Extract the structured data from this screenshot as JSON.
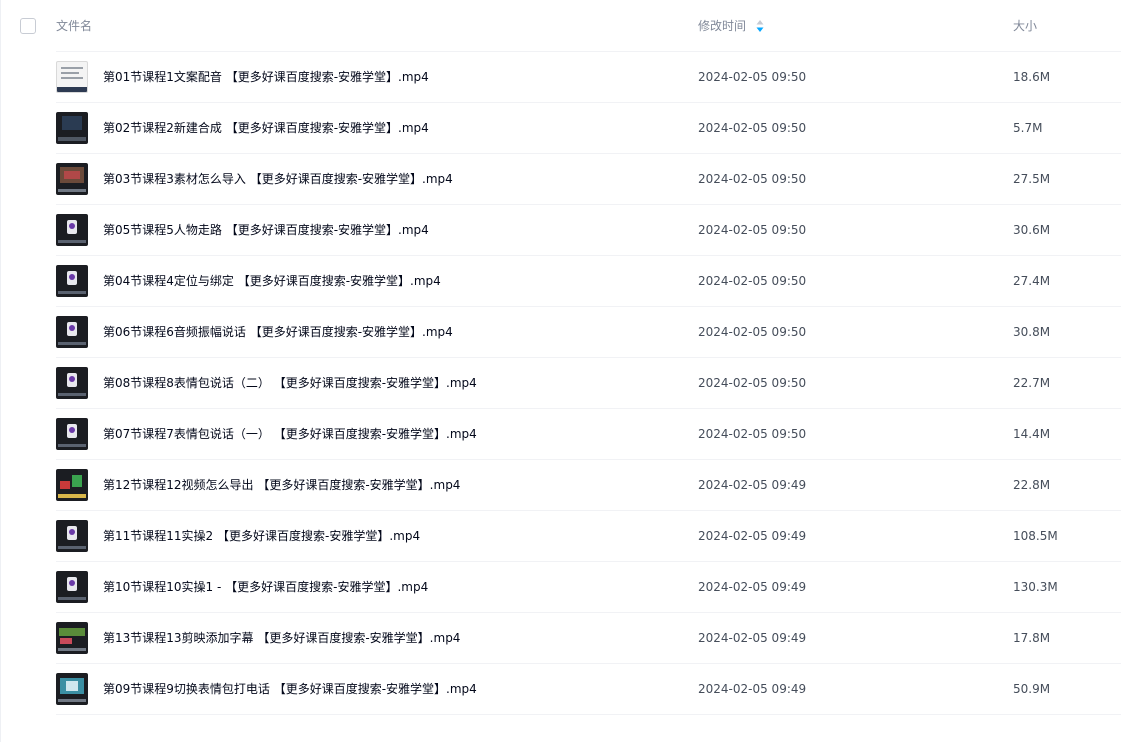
{
  "header": {
    "name_label": "文件名",
    "mtime_label": "修改时间",
    "size_label": "大小",
    "sort_indicator_icon": "sort-arrow-icon",
    "accent_color": "#06a7ff"
  },
  "files": [
    {
      "name": "第01节课程1文案配音 【更多好课百度搜索-安雅学堂】.mp4",
      "mtime": "2024-02-05 09:50",
      "size": "18.6M",
      "thumb": "doc"
    },
    {
      "name": "第02节课程2新建合成 【更多好课百度搜索-安雅学堂】.mp4",
      "mtime": "2024-02-05 09:50",
      "size": "5.7M",
      "thumb": "dark"
    },
    {
      "name": "第03节课程3素材怎么导入 【更多好课百度搜索-安雅学堂】.mp4",
      "mtime": "2024-02-05 09:50",
      "size": "27.5M",
      "thumb": "warm"
    },
    {
      "name": "第05节课程5人物走路 【更多好课百度搜索-安雅学堂】.mp4",
      "mtime": "2024-02-05 09:50",
      "size": "30.6M",
      "thumb": "fig"
    },
    {
      "name": "第04节课程4定位与绑定 【更多好课百度搜索-安雅学堂】.mp4",
      "mtime": "2024-02-05 09:50",
      "size": "27.4M",
      "thumb": "fig"
    },
    {
      "name": "第06节课程6音频振幅说话 【更多好课百度搜索-安雅学堂】.mp4",
      "mtime": "2024-02-05 09:50",
      "size": "30.8M",
      "thumb": "fig"
    },
    {
      "name": "第08节课程8表情包说话（二） 【更多好课百度搜索-安雅学堂】.mp4",
      "mtime": "2024-02-05 09:50",
      "size": "22.7M",
      "thumb": "fig"
    },
    {
      "name": "第07节课程7表情包说话（一） 【更多好课百度搜索-安雅学堂】.mp4",
      "mtime": "2024-02-05 09:50",
      "size": "14.4M",
      "thumb": "fig"
    },
    {
      "name": "第12节课程12视频怎么导出 【更多好课百度搜索-安雅学堂】.mp4",
      "mtime": "2024-02-05 09:49",
      "size": "22.8M",
      "thumb": "color"
    },
    {
      "name": "第11节课程11实操2 【更多好课百度搜索-安雅学堂】.mp4",
      "mtime": "2024-02-05 09:49",
      "size": "108.5M",
      "thumb": "fig"
    },
    {
      "name": "第10节课程10实操1 - 【更多好课百度搜索-安雅学堂】.mp4",
      "mtime": "2024-02-05 09:49",
      "size": "130.3M",
      "thumb": "fig"
    },
    {
      "name": "第13节课程13剪映添加字幕 【更多好课百度搜索-安雅学堂】.mp4",
      "mtime": "2024-02-05 09:49",
      "size": "17.8M",
      "thumb": "green"
    },
    {
      "name": "第09节课程9切换表情包打电话 【更多好课百度搜索-安雅学堂】.mp4",
      "mtime": "2024-02-05 09:49",
      "size": "50.9M",
      "thumb": "teal"
    }
  ]
}
